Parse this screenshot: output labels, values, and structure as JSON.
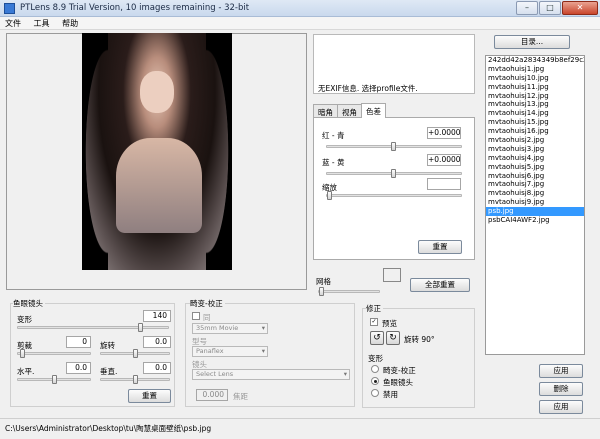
{
  "window": {
    "title": "PTLens 8.9 Trial Version, 10 images remaining - 32-bit"
  },
  "menu": [
    "文件",
    "工具",
    "帮助"
  ],
  "exif": {
    "text": "无EXIF信息. 选择profile文件."
  },
  "tabs": [
    "暗角",
    "视角",
    "色差"
  ],
  "chromatic": {
    "red_cyan_label": "红 - 青",
    "red_cyan_value": "+0.0000",
    "red_cyan_level": 0.5,
    "blue_yellow_label": "蓝 - 黄",
    "blue_yellow_value": "+0.0000",
    "blue_yellow_level": 0.5,
    "zoom_label": "缩放",
    "zoom_level": 0.0,
    "reset_label": "重置"
  },
  "grid": {
    "label": "网格",
    "reset_all_label": "全部重置",
    "level": 0.0
  },
  "directory_button": "目录...",
  "files": [
    "242dd42a2834349b8ef29c29c9ea",
    "mvtaohuisj1.jpg",
    "mvtaohuisj10.jpg",
    "mvtaohuisj11.jpg",
    "mvtaohuisj12.jpg",
    "mvtaohuisj13.jpg",
    "mvtaohuisj14.jpg",
    "mvtaohuisj15.jpg",
    "mvtaohuisj16.jpg",
    "mvtaohuisj2.jpg",
    "mvtaohuisj3.jpg",
    "mvtaohuisj4.jpg",
    "mvtaohuisj5.jpg",
    "mvtaohuisj6.jpg",
    "mvtaohuisj7.jpg",
    "mvtaohuisj8.jpg",
    "mvtaohuisj9.jpg",
    "psb.jpg",
    "psbCAI4AWF2.jpg"
  ],
  "selected_file": "psb.jpg",
  "fisheye": {
    "title": "鱼眼镜头",
    "distort_label": "变形",
    "distort_value": "140",
    "distort_level": 0.82,
    "crop_label": "剪裁",
    "crop_value": "0",
    "rotate_label": "旋转",
    "rotate_value": "0.0",
    "horizontal_label": "水平.",
    "horizontal_value": "0.0",
    "vertical_label": "垂直.",
    "vertical_value": "0.0",
    "reset_label": "重置"
  },
  "distortion": {
    "title": "畸变-校正",
    "same_label": "同",
    "format_select": "35mm Movie",
    "model_label": "型号",
    "model_select": "Panaflex",
    "lens_label": "镜头",
    "lens_select": "Select Lens",
    "focal_value": "0.000",
    "focal_label": "焦距"
  },
  "correction": {
    "title": "修正",
    "preview_label": "预览",
    "rotate_label": "旋转 90°",
    "shape_label": "变形",
    "options": [
      "畸变-校正",
      "鱼眼镜头",
      "禁用"
    ],
    "selected_option": "鱼眼镜头"
  },
  "side_buttons": {
    "apply1": "应用",
    "delete1": "删除",
    "apply2": "应用",
    "delete2": "删除"
  },
  "status": {
    "path": "C:\\Users\\Administrator\\Desktop\\tu\\陶慧桌面壁纸\\psb.jpg"
  }
}
